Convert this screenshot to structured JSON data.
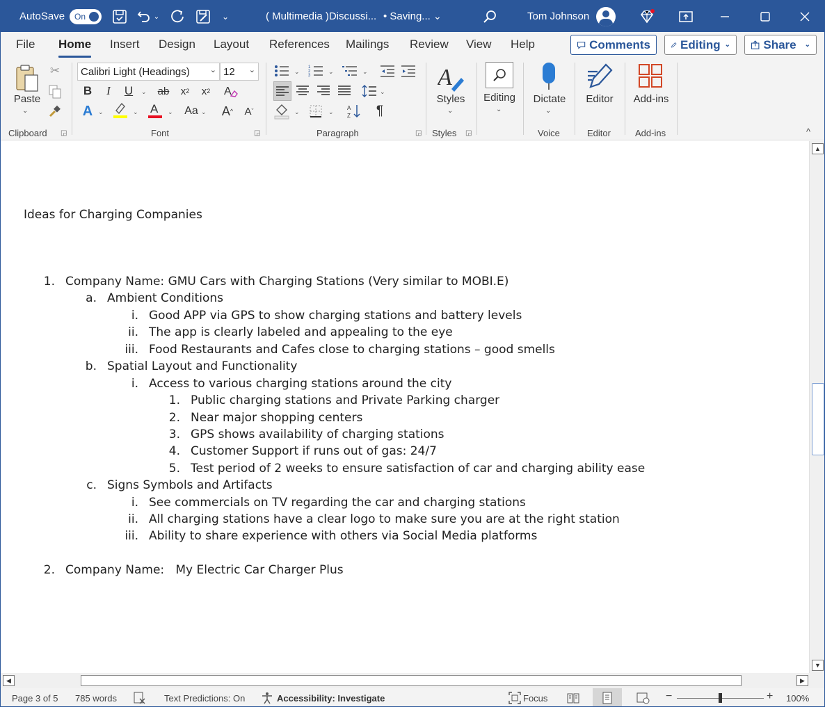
{
  "titlebar": {
    "autosave_label": "AutoSave",
    "autosave_state": "On",
    "doc_title": "( Multimedia )Discussi...",
    "save_status": "• Saving...",
    "user_name": "Tom Johnson"
  },
  "menu": {
    "tabs": [
      "File",
      "Home",
      "Insert",
      "Design",
      "Layout",
      "References",
      "Mailings",
      "Review",
      "View",
      "Help"
    ],
    "active": "Home",
    "comments_label": "Comments",
    "editing_label": "Editing",
    "share_label": "Share"
  },
  "ribbon": {
    "paste_label": "Paste",
    "font_name": "Calibri Light (Headings)",
    "font_size": "12",
    "styles_label": "Styles",
    "editing_label": "Editing",
    "dictate_label": "Dictate",
    "editor_label": "Editor",
    "addins_label": "Add-ins",
    "groups": {
      "clipboard": "Clipboard",
      "font": "Font",
      "paragraph": "Paragraph",
      "styles": "Styles",
      "voice": "Voice",
      "editor": "Editor",
      "addins": "Add-ins"
    },
    "font_buttons": {
      "bold": "B",
      "italic": "I",
      "underline": "U",
      "strike": "ab",
      "change_case": "Aa",
      "grow": "A",
      "shrink": "A"
    },
    "colors": {
      "highlight": "#ffff00",
      "font_color": "#e81123",
      "accent": "#2b579a"
    }
  },
  "document": {
    "heading": "Ideas for Charging Companies",
    "items": [
      {
        "num": "1.",
        "text": "Company Name: GMU Cars with Charging Stations (Very similar to MOBI.E)"
      },
      {
        "num": "a.",
        "text": "Ambient Conditions"
      },
      {
        "num": "i.",
        "text": "Good APP via GPS to show charging stations and battery levels"
      },
      {
        "num": "ii.",
        "text": "The app is clearly labeled and appealing to the eye"
      },
      {
        "num": "iii.",
        "text": "Food Restaurants and Cafes close to charging stations – good smells"
      },
      {
        "num": "b.",
        "text": "Spatial Layout and Functionality"
      },
      {
        "num": "i.",
        "text": "Access to various charging stations around the city"
      },
      {
        "num": "1.",
        "text": "Public charging stations and Private Parking charger"
      },
      {
        "num": "2.",
        "text": "Near major shopping centers"
      },
      {
        "num": "3.",
        "text": "GPS shows availability of charging stations"
      },
      {
        "num": "4.",
        "text": "Customer Support if runs out of gas: 24/7"
      },
      {
        "num": "5.",
        "text": "Test period of 2 weeks to ensure satisfaction of car and charging ability ease"
      },
      {
        "num": "c.",
        "text": "Signs Symbols and Artifacts"
      },
      {
        "num": "i.",
        "text": "See commercials on TV regarding the car and charging stations"
      },
      {
        "num": "ii.",
        "text": "All charging stations have a clear logo to make sure you are at the right station"
      },
      {
        "num": "iii.",
        "text": "Ability to share experience with others via Social Media platforms"
      },
      {
        "num": "2.",
        "text": "Company Name:   My Electric Car Charger Plus"
      }
    ]
  },
  "status": {
    "page": "Page 3 of 5",
    "words": "785 words",
    "text_predictions": "Text Predictions: On",
    "accessibility": "Accessibility: Investigate",
    "focus": "Focus",
    "zoom": "100%",
    "zoom_minus": "−",
    "zoom_plus": "+"
  }
}
